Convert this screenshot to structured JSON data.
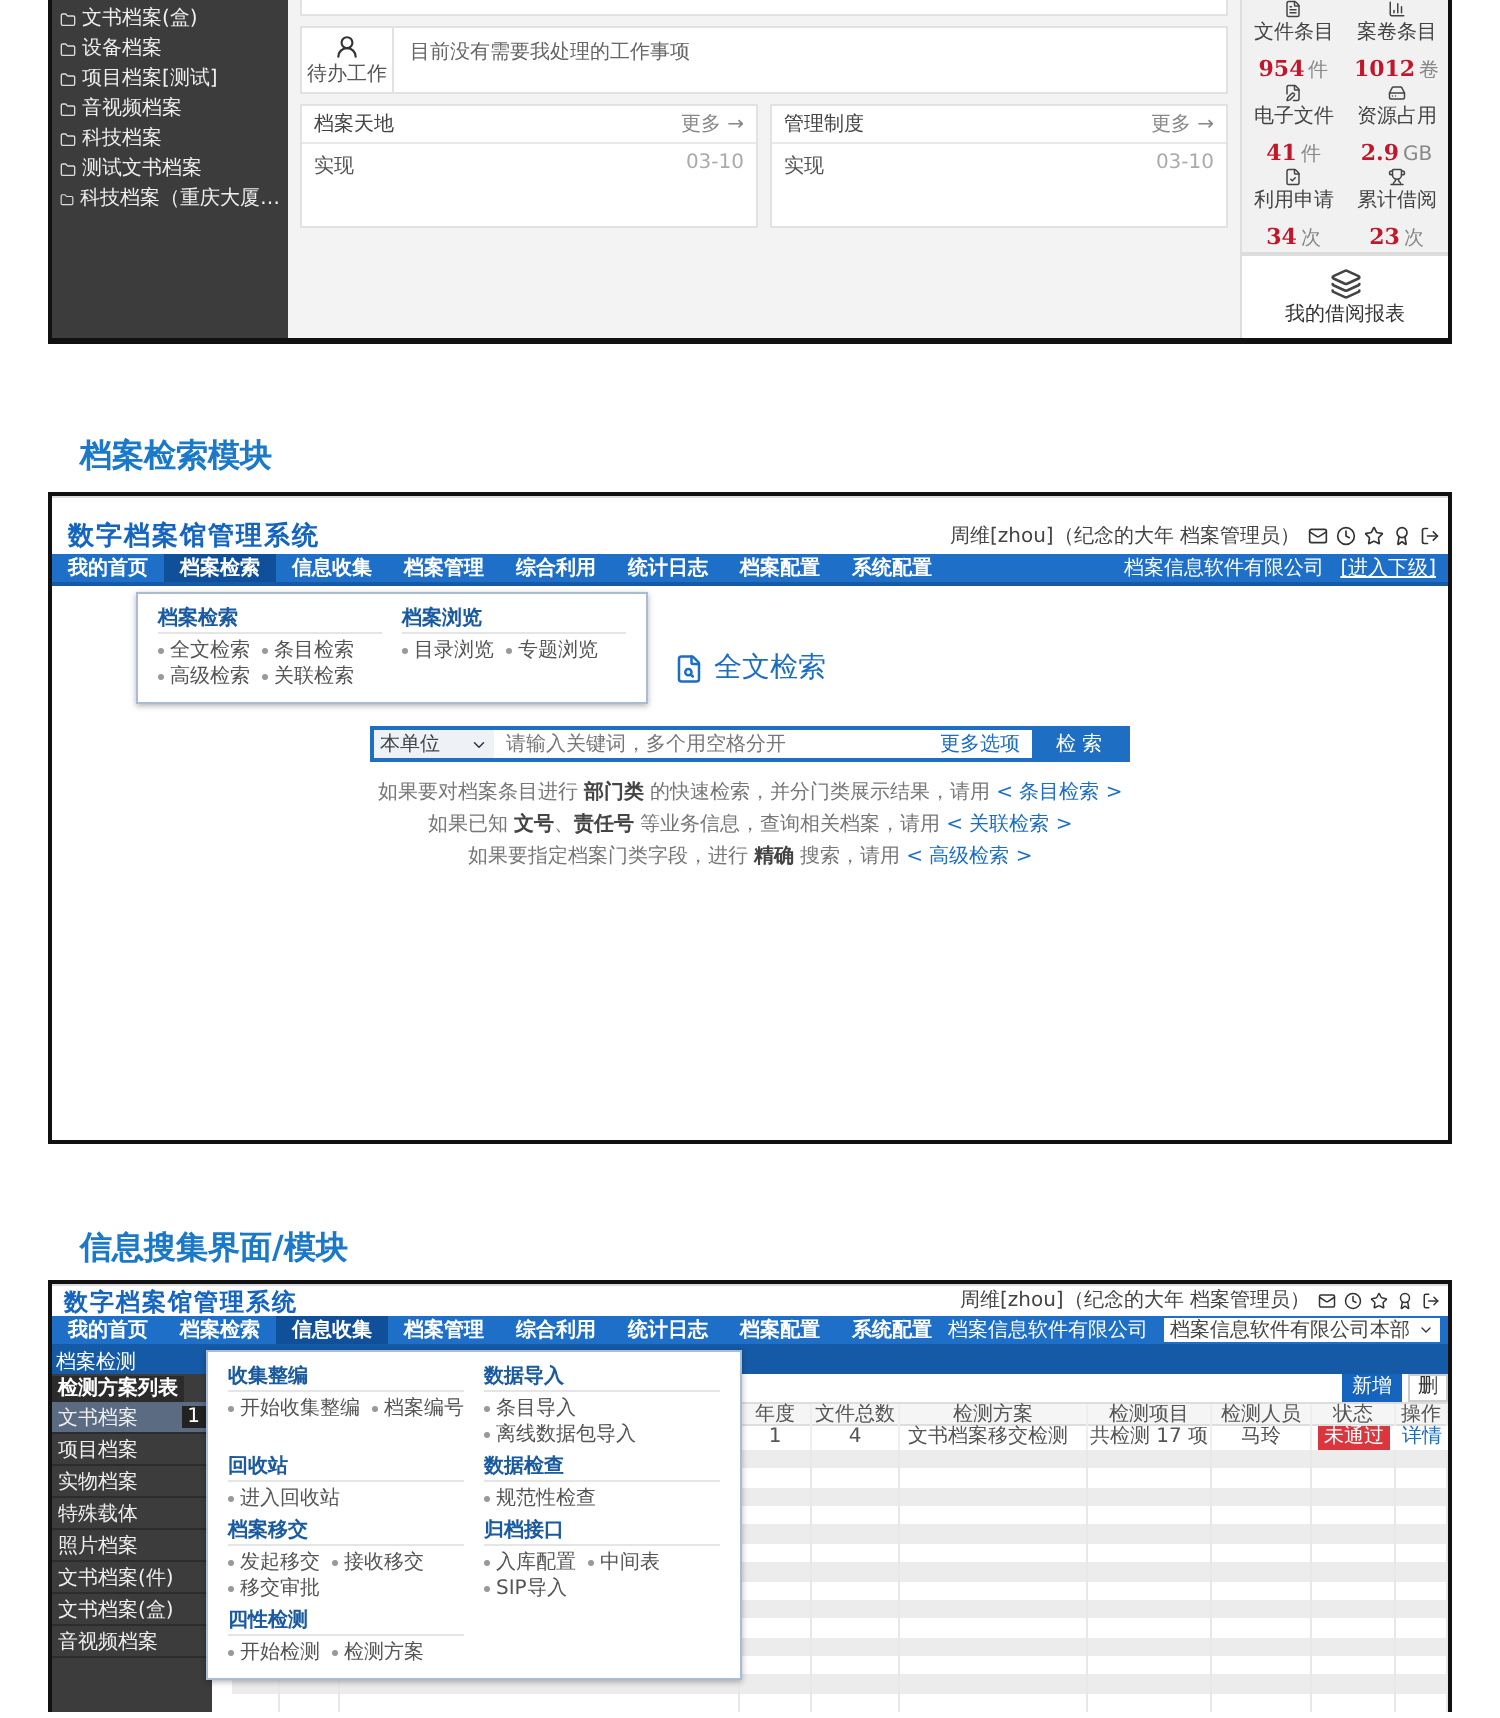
{
  "dashboard": {
    "sidebar_items": [
      "文书档案(盒)",
      "设备档案",
      "项目档案[测试]",
      "音视频档案",
      "科技档案",
      "测试文书档案",
      "科技档案（重庆大厦…"
    ],
    "todo": {
      "label": "待办工作",
      "message": "目前没有需要我处理的工作事项"
    },
    "panels": [
      {
        "title": "档案天地",
        "more": "更多 →",
        "items": [
          {
            "title": "实现",
            "date": "03-10"
          }
        ]
      },
      {
        "title": "管理制度",
        "more": "更多 →",
        "items": [
          {
            "title": "实现",
            "date": "03-10"
          }
        ]
      }
    ],
    "stats": [
      {
        "label": "文件条目",
        "value": "954",
        "unit": "件"
      },
      {
        "label": "案卷条目",
        "value": "1012",
        "unit": "卷"
      },
      {
        "label": "电子文件",
        "value": "41",
        "unit": "件"
      },
      {
        "label": "资源占用",
        "value": "2.9",
        "unit": "GB"
      },
      {
        "label": "利用申请",
        "value": "34",
        "unit": "次"
      },
      {
        "label": "累计借阅",
        "value": "23",
        "unit": "次"
      }
    ],
    "bottom_tile": "我的借阅报表"
  },
  "search_heading": "档案检索模块",
  "search_page": {
    "app_title": "数字档案馆管理系统",
    "user_text": "周维[zhou]（纪念的大年 档案管理员）",
    "company": "档案信息软件有限公司",
    "enter_sub": "[进入下级]",
    "nav": [
      {
        "label": "我的首页",
        "selected": false
      },
      {
        "label": "档案检索",
        "selected": true
      },
      {
        "label": "信息收集",
        "selected": false
      },
      {
        "label": "档案管理",
        "selected": false
      },
      {
        "label": "综合利用",
        "selected": false
      },
      {
        "label": "统计日志",
        "selected": false
      },
      {
        "label": "档案配置",
        "selected": false
      },
      {
        "label": "系统配置",
        "selected": false
      }
    ],
    "menu": [
      {
        "title": "档案检索",
        "items": [
          "全文检索",
          "条目检索",
          "高级检索",
          "关联检索"
        ]
      },
      {
        "title": "档案浏览",
        "items": [
          "目录浏览",
          "专题浏览"
        ]
      }
    ],
    "search_title": "全文检索",
    "scope": "本单位",
    "placeholder": "请输入关键词，多个用空格分开",
    "more_options": "更多选项",
    "search_button": "检 索",
    "hints": [
      {
        "text": "如果要对档案条目进行 **部门类** 的快速检索，并分门类展示结果，请用",
        "link": "< 条目检索 >"
      },
      {
        "text": "如果已知 **文号**、**责任号** 等业务信息，查询相关档案，请用",
        "link": "< 关联检索 >"
      },
      {
        "text": "如果要指定档案门类字段，进行 **精确** 搜索，请用",
        "link": "< 高级检索 >"
      }
    ]
  },
  "collect_heading": "信息搜集界面/模块",
  "collect_page": {
    "app_title": "数字档案馆管理系统",
    "user_text": "周维[zhou]（纪念的大年 档案管理员）",
    "company": "档案信息软件有限公司",
    "unit_select": "档案信息软件有限公司本部",
    "nav": [
      {
        "label": "我的首页",
        "selected": false
      },
      {
        "label": "档案检索",
        "selected": false
      },
      {
        "label": "信息收集",
        "selected": true
      },
      {
        "label": "档案管理",
        "selected": false
      },
      {
        "label": "综合利用",
        "selected": false
      },
      {
        "label": "统计日志",
        "selected": false
      },
      {
        "label": "档案配置",
        "selected": false
      },
      {
        "label": "系统配置",
        "selected": false
      }
    ],
    "subheader": "档案检测",
    "sidebar_tab": "检测方案列表",
    "sidebar_items": [
      {
        "label": "文书档案",
        "badge": "1",
        "selected": true
      },
      {
        "label": "项目档案",
        "selected": false
      },
      {
        "label": "实物档案",
        "selected": false
      },
      {
        "label": "特殊载体",
        "selected": false
      },
      {
        "label": "照片档案",
        "selected": false
      },
      {
        "label": "文书档案(件)",
        "selected": false
      },
      {
        "label": "文书档案(盒)",
        "selected": false
      },
      {
        "label": "音视频档案",
        "selected": false
      }
    ],
    "menu": [
      {
        "title": "收集整编",
        "items": [
          "开始收集整编",
          "档案编号"
        ]
      },
      {
        "title": "数据导入",
        "items": [
          "条目导入",
          "离线数据包导入"
        ]
      },
      {
        "title": "回收站",
        "items": [
          "进入回收站"
        ]
      },
      {
        "title": "数据检查",
        "items": [
          "规范性检查"
        ]
      },
      {
        "title": "档案移交",
        "items": [
          "发起移交",
          "接收移交",
          "移交审批"
        ]
      },
      {
        "title": "归档接口",
        "items": [
          "入库配置",
          "中间表",
          "SIP导入"
        ]
      },
      {
        "title": "四性检测",
        "items": [
          "开始检测",
          "检测方案"
        ]
      }
    ],
    "toolbar": [
      "新增",
      "删"
    ],
    "columns": [
      "年度",
      "文件总数",
      "检测方案",
      "检测项目",
      "检测人员",
      "状态",
      "操作"
    ],
    "rows": [
      {
        "year": "1",
        "file_count": "4",
        "plan": "文书档案移交检测",
        "items": "共检测 17 项",
        "inspector": "马玲",
        "status": "未通过",
        "passed": false,
        "action": "详情"
      }
    ]
  }
}
